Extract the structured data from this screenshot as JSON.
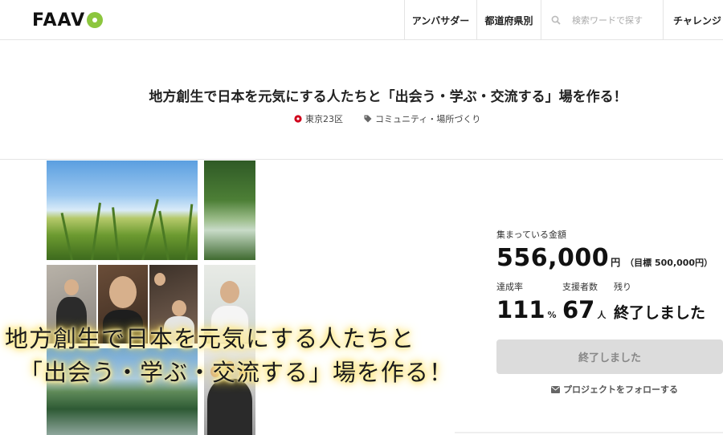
{
  "header": {
    "logo": "FAAVO",
    "nav": {
      "ambassador": "アンバサダー",
      "prefecture": "都道府県別",
      "search_placeholder": "検索ワードで探す",
      "challenge": "チャレンジ"
    }
  },
  "project": {
    "title": "地方創生で日本を元気にする人たちと「出会う・学ぶ・交流する」場を作る！",
    "location": "東京23区",
    "category": "コミュニティ・場所づくり",
    "image_overlay": {
      "line1": "地方創生で日本を元気にする人たちと",
      "line2": "「出会う・学ぶ・交流する」場を作る！"
    }
  },
  "funding": {
    "collected_label": "集まっている金額",
    "amount": "556,000",
    "yen": "円",
    "goal": "（目標 500,000円）",
    "rate_label": "達成率",
    "rate_value": "111",
    "rate_unit": "%",
    "supporters_label": "支援者数",
    "supporters_value": "67",
    "supporters_unit": "人",
    "remaining_label": "残り",
    "remaining_value": "終了しました",
    "button_label": "終了しました",
    "follow_label": "プロジェクトをフォローする"
  },
  "colors": {
    "brand_green": "#8cc63e",
    "location_red": "#d0021b",
    "button_disabled": "#dcdcdc"
  }
}
